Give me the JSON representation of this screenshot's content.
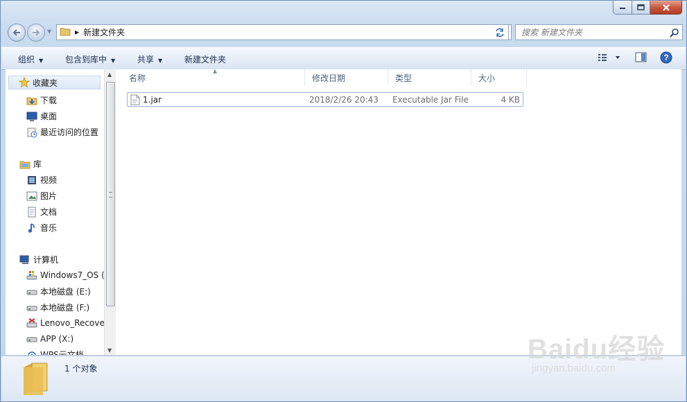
{
  "window": {
    "caption": {
      "minimize_icon": "minimize-icon",
      "maximize_icon": "maximize-icon",
      "close_icon": "close-icon"
    }
  },
  "address_bar": {
    "path": "新建文件夹",
    "search_placeholder": "搜索 新建文件夹"
  },
  "toolbar": {
    "organize": "组织",
    "include_in_library": "包含到库中",
    "share": "共享",
    "new_folder": "新建文件夹"
  },
  "sidebar": {
    "favorites": {
      "label": "收藏夹",
      "items": [
        {
          "label": "下载",
          "icon": "downloads-icon"
        },
        {
          "label": "桌面",
          "icon": "desktop-icon"
        },
        {
          "label": "最近访问的位置",
          "icon": "recent-places-icon"
        }
      ]
    },
    "libraries": {
      "label": "库",
      "items": [
        {
          "label": "视频",
          "icon": "videos-icon"
        },
        {
          "label": "图片",
          "icon": "pictures-icon"
        },
        {
          "label": "文档",
          "icon": "documents-icon"
        },
        {
          "label": "音乐",
          "icon": "music-icon"
        }
      ]
    },
    "computer": {
      "label": "计算机",
      "items": [
        {
          "label": "Windows7_OS (",
          "icon": "system-drive-icon"
        },
        {
          "label": "本地磁盘 (E:)",
          "icon": "drive-icon"
        },
        {
          "label": "本地磁盘 (F:)",
          "icon": "drive-icon"
        },
        {
          "label": "Lenovo_Recove",
          "icon": "recovery-drive-icon"
        },
        {
          "label": "APP (X:)",
          "icon": "drive-icon"
        },
        {
          "label": "WPS云文档",
          "icon": "cloud-icon"
        }
      ]
    }
  },
  "columns": {
    "name": "名称",
    "date": "修改日期",
    "type": "类型",
    "size": "大小"
  },
  "files": [
    {
      "name": "1.jar",
      "date": "2018/2/26 20:43",
      "type": "Executable Jar File",
      "size": "4 KB"
    }
  ],
  "status": {
    "count": "1 个对象"
  },
  "watermark": {
    "text": "Baidu经验",
    "url": "jingyan.baidu.com"
  }
}
